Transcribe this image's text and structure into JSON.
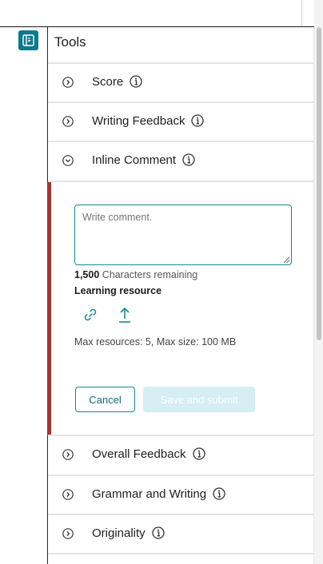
{
  "panel": {
    "title": "Tools",
    "toggle_icon": "panel-toggle-icon",
    "accent": "#0d7a8a"
  },
  "sections_top": [
    {
      "label": "Score",
      "icon": "chevron-right-circle-icon"
    },
    {
      "label": "Writing Feedback",
      "icon": "chevron-right-circle-icon"
    },
    {
      "label": "Inline Comment",
      "icon": "chevron-down-circle-icon"
    }
  ],
  "inline_comment": {
    "placeholder": "Write comment.",
    "chars_count": "1,500",
    "chars_suffix": " Characters remaining",
    "learning_resource_label": "Learning resource",
    "max_resources_text": "Max resources: 5, Max size: 100 MB",
    "cancel_label": "Cancel",
    "submit_label": "Save and submit",
    "link_icon": "link-icon",
    "upload_icon": "upload-icon",
    "marker_color": "#a83232"
  },
  "sections_bottom": [
    {
      "label": "Overall Feedback",
      "icon": "chevron-right-circle-icon"
    },
    {
      "label": "Grammar and Writing",
      "icon": "chevron-right-circle-icon"
    },
    {
      "label": "Originality",
      "icon": "chevron-right-circle-icon"
    }
  ]
}
